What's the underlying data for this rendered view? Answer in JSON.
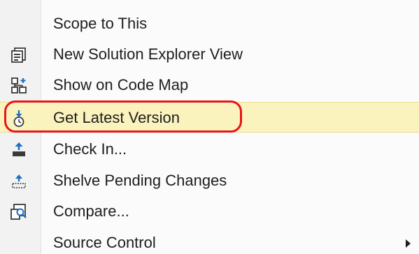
{
  "menu": {
    "items": [
      {
        "label": "Scope to This",
        "icon": ""
      },
      {
        "label": "New Solution Explorer View",
        "icon": "solution-explorer-view-icon"
      },
      {
        "label": "Show on Code Map",
        "icon": "code-map-icon"
      },
      {
        "label": "Get Latest Version",
        "icon": "get-latest-icon",
        "highlighted": true
      },
      {
        "label": "Check In...",
        "icon": "check-in-icon"
      },
      {
        "label": "Shelve Pending Changes",
        "icon": "shelve-icon"
      },
      {
        "label": "Compare...",
        "icon": "compare-icon"
      },
      {
        "label": "Source Control",
        "icon": "",
        "has_submenu": true
      }
    ]
  },
  "colors": {
    "highlight_bg": "#fbf3bd",
    "annotation_ring": "#e8141a",
    "icon_blue": "#1e6fc4",
    "icon_dark": "#3a3a3a"
  }
}
